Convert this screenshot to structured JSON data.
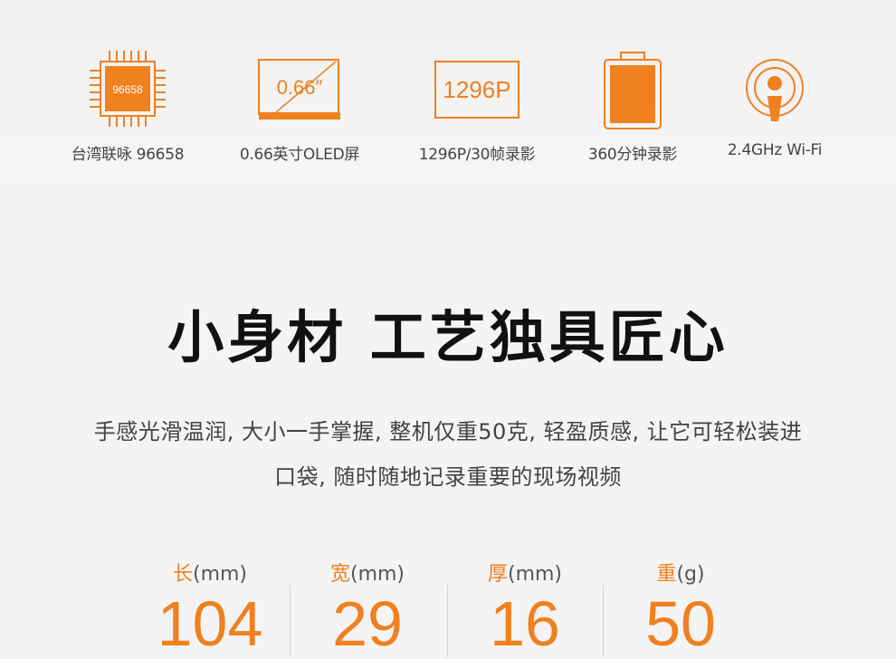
{
  "features": [
    {
      "icon": "chip-icon",
      "chip_text": "96658",
      "label": "台湾联咏 96658"
    },
    {
      "icon": "screen-icon",
      "screen_text": "0.66″",
      "label": "0.66英寸OLED屏"
    },
    {
      "icon": "resolution-icon",
      "screen_text": "1296P",
      "label": "1296P/30帧录影"
    },
    {
      "icon": "battery-icon",
      "label": "360分钟录影"
    },
    {
      "icon": "wifi-icon",
      "label": "2.4GHz Wi-Fi"
    }
  ],
  "headline": "小身材 工艺独具匠心",
  "description": {
    "line1": "手感光滑温润, 大小一手掌握, 整机仅重50克, 轻盈质感, 让它可轻松装进",
    "line2": "口袋, 随时随地记录重要的现场视频"
  },
  "specs": [
    {
      "label": "长",
      "unit": "(mm)",
      "value": "104"
    },
    {
      "label": "宽",
      "unit": "(mm)",
      "value": "29"
    },
    {
      "label": "厚",
      "unit": "(mm)",
      "value": "16"
    },
    {
      "label": "重",
      "unit": "(g)",
      "value": "50"
    }
  ],
  "colors": {
    "accent": "#f08020",
    "text": "#333333",
    "background": "#f4f4f4"
  }
}
